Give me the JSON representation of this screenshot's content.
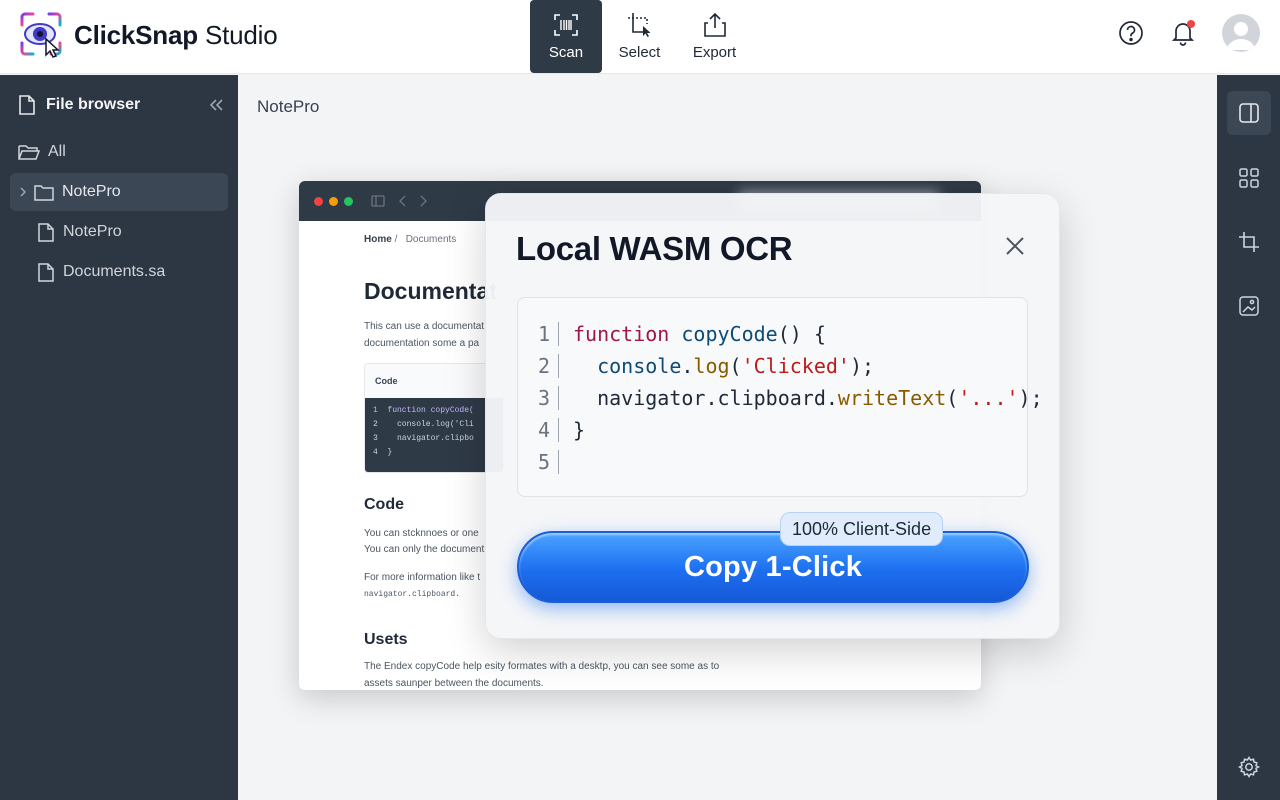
{
  "app": {
    "name_bold": "ClickSnap",
    "name_rest": " Studio"
  },
  "toolbar": {
    "items": [
      {
        "label": "Scan",
        "icon": "barcode-scan-icon",
        "active": true
      },
      {
        "label": "Select",
        "icon": "select-crop-icon",
        "active": false
      },
      {
        "label": "Export",
        "icon": "share-export-icon",
        "active": false
      }
    ]
  },
  "header_actions": {
    "help_icon": "help-circle-icon",
    "notification_icon": "bell-icon",
    "notification_dot_color": "#ef4444",
    "avatar_icon": "user-avatar-icon"
  },
  "sidebar": {
    "title": "File browser",
    "items": [
      {
        "label": "All",
        "icon": "folder-open-icon"
      },
      {
        "label": "NotePro",
        "icon": "folder-icon",
        "selected": true,
        "expandable": true
      },
      {
        "label": "NotePro",
        "icon": "file-icon"
      },
      {
        "label": "Documents.sa",
        "icon": "file-icon"
      }
    ]
  },
  "main": {
    "title": "NotePro"
  },
  "background_doc": {
    "breadcrumb_home": "Home",
    "breadcrumb_sep": "/",
    "breadcrumb_current": "Documents",
    "heading": "Documentat",
    "intro_line1": "This can use a  documentat",
    "intro_line2": "documentation some a pa",
    "code_tab": "Code",
    "code_lines": [
      "1  function copyCode(",
      "2    console.log('Cli",
      "3    navigator.clipbo",
      "4  }"
    ],
    "section_code": "Code",
    "code_p1": "You can stcknnoes or one",
    "code_p2": "You can only the document",
    "code_p3": "For more information like t",
    "code_p4": "navigator.clipboard.",
    "section_usets": "Usets",
    "usets_p1": "The Endex copyCode help esity formates with a desktp, you can see some as to",
    "usets_p2": "assets saunper between the documents."
  },
  "modal": {
    "title": "Local WASM OCR",
    "close_icon": "close-icon",
    "code": {
      "line_numbers": [
        "1",
        "2",
        "3",
        "4",
        "5"
      ],
      "l1_kw": "function",
      "l1_fn": " copyCode",
      "l1_rest": "() {",
      "l2_obj": "  console",
      "l2_dot": ".",
      "l2_meth": "log",
      "l2_open": "(",
      "l2_str": "'Clicked'",
      "l2_close": ");",
      "l3_obj": "  navigator.clipboard.",
      "l3_meth": "writeText",
      "l3_open": "(",
      "l3_str": "'...'",
      "l3_close": ");",
      "l4": "}"
    },
    "badge": "100% Client-Side",
    "button": "Copy 1-Click",
    "accent": "#1d6ff0"
  },
  "rail": {
    "items": [
      {
        "icon": "panel-right-icon",
        "active": true
      },
      {
        "icon": "grid-icon",
        "active": false
      },
      {
        "icon": "crop-icon",
        "active": false
      },
      {
        "icon": "image-frame-icon",
        "active": false
      }
    ],
    "settings_icon": "gear-icon"
  }
}
